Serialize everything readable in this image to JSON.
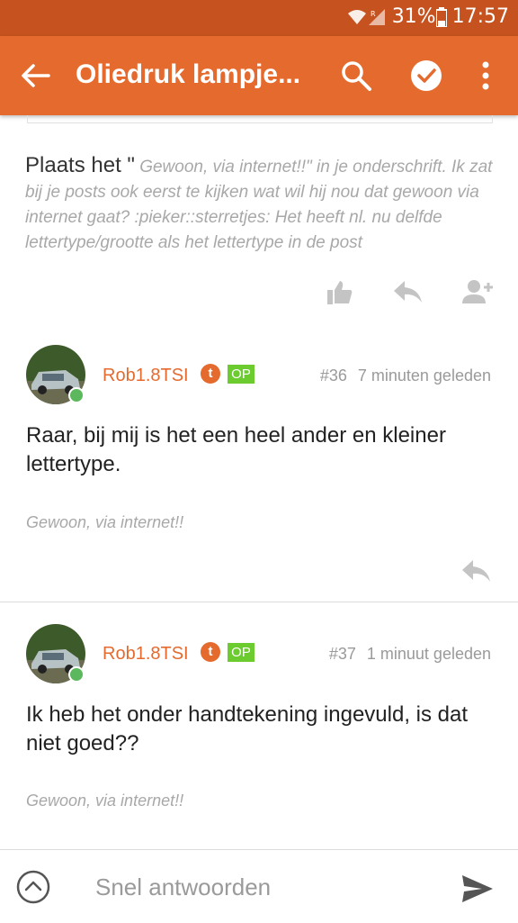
{
  "status_bar": {
    "battery": "31%",
    "time": "17:57",
    "signal_label": "R"
  },
  "app_bar": {
    "title": "Oliedruk lampje...",
    "icons": [
      "back-arrow-icon",
      "search-icon",
      "check-circle-icon",
      "more-vert-icon"
    ]
  },
  "posts": [
    {
      "lead": "Plaats het \"",
      "quote": " Gewoon, via internet!!\" in je onderschrift. Ik zat bij je posts ook eerst te kijken wat wil hij nou dat gewoon via internet gaat? :pieker::sterretjes: Het heeft nl. nu delfde lettertype/grootte als het lettertype in de post"
    },
    {
      "username": "Rob1.8TSI",
      "badge_t": "t",
      "badge_op": "OP",
      "number": "#36",
      "time": "7 minuten geleden",
      "body": "Raar, bij mij is het een heel ander en kleiner lettertype.",
      "signature": "Gewoon, via internet!!"
    },
    {
      "username": "Rob1.8TSI",
      "badge_t": "t",
      "badge_op": "OP",
      "number": "#37",
      "time": "1 minuut geleden",
      "body": "Ik heb het onder handtekening ingevuld, is dat niet goed??",
      "signature": "Gewoon, via internet!!"
    }
  ],
  "reply_bar": {
    "placeholder": "Snel antwoorden"
  },
  "colors": {
    "status_bar": "#c5521f",
    "app_bar": "#e56a2e",
    "username": "#e56a2e",
    "op_badge": "#6ccc2f",
    "online": "#5cb85c"
  }
}
